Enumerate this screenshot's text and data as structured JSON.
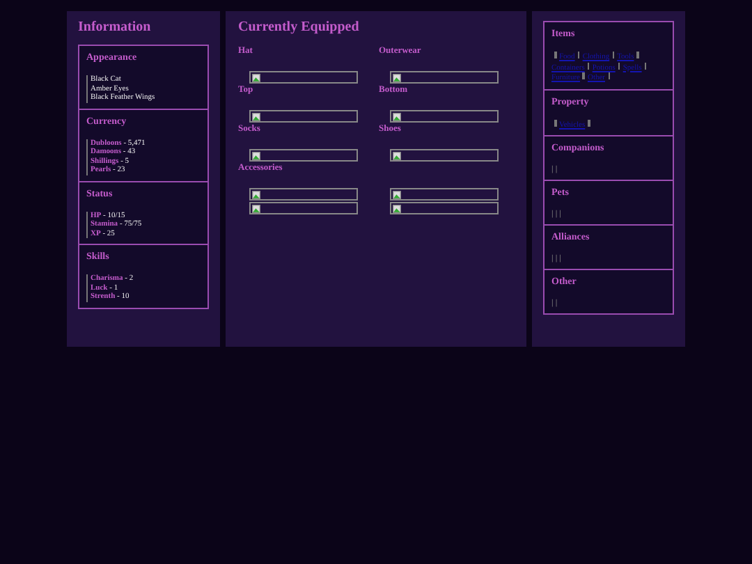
{
  "information": {
    "title": "Information",
    "sections": [
      {
        "title": "Appearance",
        "entries": [
          "Black Cat",
          "Amber Eyes",
          "Black Feather Wings"
        ]
      },
      {
        "title": "Currency",
        "entries": [
          "**Dubloons** - 5,471",
          "**Damoons** - 43",
          "**Shillings** - 5",
          "**Pearls** - 23"
        ]
      },
      {
        "title": "Status",
        "entries": [
          "**HP** - 10/15",
          "**Stamina** - 75/75",
          "**XP** - 25"
        ]
      },
      {
        "title": "Skills",
        "entries": [
          "**Charisma** - 2",
          "**Luck** - 1",
          "**Strenth** - 10"
        ]
      }
    ]
  },
  "equipped": {
    "title": "Currently Equipped",
    "slots": [
      {
        "label": "Hat",
        "images": [
          {
            "kind": "broken"
          }
        ]
      },
      {
        "label": "Outerwear",
        "images": [
          {
            "kind": "broken"
          }
        ]
      },
      {
        "label": "Top",
        "images": [
          {
            "kind": "broken"
          }
        ]
      },
      {
        "label": "Bottom",
        "images": [
          {
            "kind": "broken"
          }
        ]
      },
      {
        "label": "Socks",
        "images": [
          {
            "kind": "broken"
          }
        ]
      },
      {
        "label": "Shoes",
        "images": [
          {
            "kind": "broken"
          }
        ]
      },
      {
        "label": "Accessories",
        "images": [
          {
            "kind": "broken"
          },
          {
            "kind": "broken"
          }
        ]
      },
      {
        "images": [
          {
            "kind": "broken"
          },
          {
            "kind": "broken"
          }
        ]
      }
    ]
  },
  "inventory": [
    {
      "title": "Items",
      "links": [
        "Food",
        "Clothing",
        "Tools",
        "Containers",
        "Potions",
        "Spells",
        "Furniture",
        "Other"
      ]
    },
    {
      "title": "Property",
      "links": [
        "Vehicles"
      ]
    },
    {
      "title": "Companions",
      "bars": "| |"
    },
    {
      "title": "Pets",
      "bars": "| | |"
    },
    {
      "title": "Alliances",
      "bars": "| | |"
    },
    {
      "title": "Other",
      "bars": "| |"
    }
  ]
}
